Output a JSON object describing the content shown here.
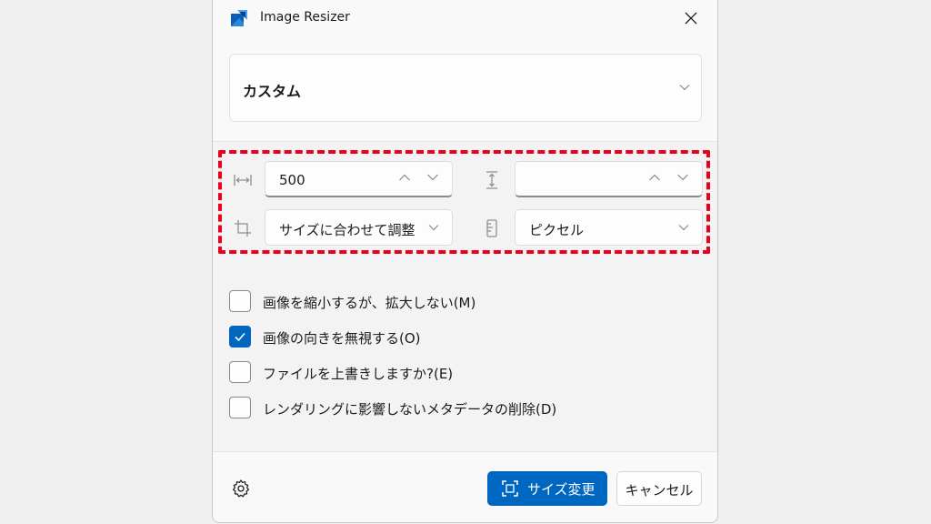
{
  "window": {
    "title": "Image Resizer"
  },
  "preset": {
    "selected": "カスタム"
  },
  "size": {
    "width_value": "500",
    "height_value": "",
    "fit_mode": "サイズに合わせて調整",
    "unit": "ピクセル"
  },
  "options": [
    {
      "label": "画像を縮小するが、拡大しない(M)",
      "checked": false
    },
    {
      "label": "画像の向きを無視する(O)",
      "checked": true
    },
    {
      "label": "ファイルを上書きしますか?(E)",
      "checked": false
    },
    {
      "label": "レンダリングに影響しないメタデータの削除(D)",
      "checked": false
    }
  ],
  "footer": {
    "resize_label": "サイズ変更",
    "cancel_label": "キャンセル"
  },
  "colors": {
    "accent": "#0067c0",
    "highlight": "#e8001c"
  }
}
